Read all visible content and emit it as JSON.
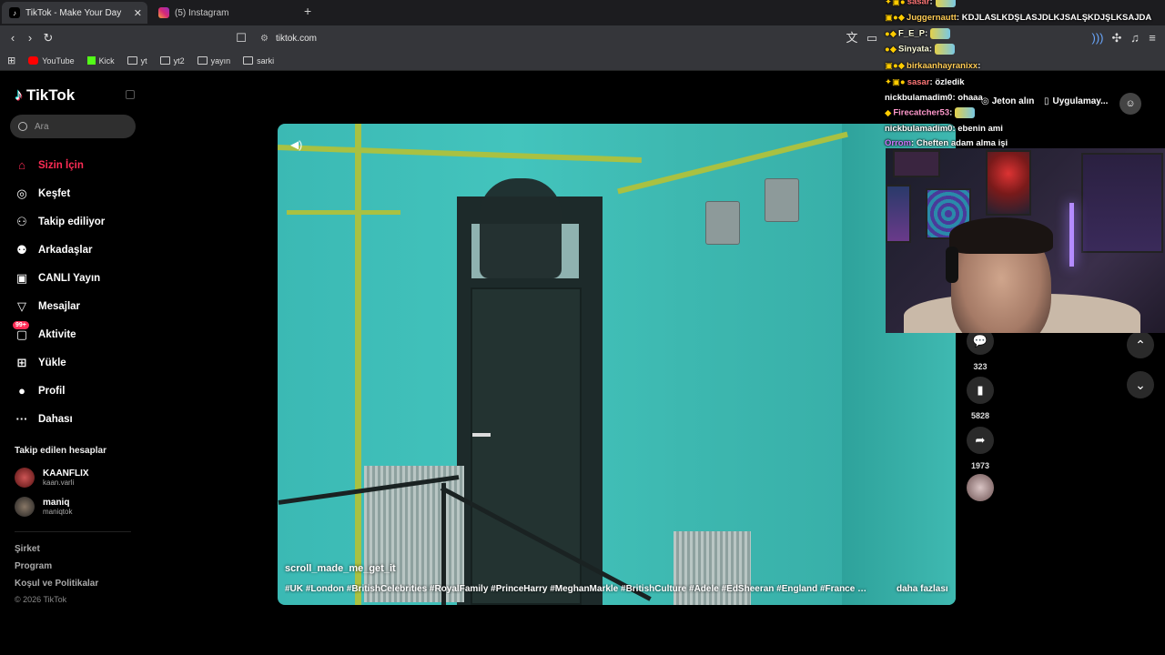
{
  "browser": {
    "tabs": [
      {
        "title": "TikTok - Make Your Day",
        "active": true
      },
      {
        "title": "(5) Instagram",
        "active": false
      }
    ],
    "url": "tiktok.com",
    "bookmarks": [
      "YouTube",
      "Kick",
      "yt",
      "yt2",
      "yayın",
      "sarki"
    ]
  },
  "tiktok": {
    "logo": "TikTok",
    "search_placeholder": "Ara",
    "nav": [
      {
        "label": "Sizin İçin",
        "icon": "home-icon",
        "active": true
      },
      {
        "label": "Keşfet",
        "icon": "compass-icon"
      },
      {
        "label": "Takip ediliyor",
        "icon": "following-icon"
      },
      {
        "label": "Arkadaşlar",
        "icon": "friends-icon"
      },
      {
        "label": "CANLI Yayın",
        "icon": "live-icon"
      },
      {
        "label": "Mesajlar",
        "icon": "messages-icon"
      },
      {
        "label": "Aktivite",
        "icon": "activity-icon",
        "badge": "99+"
      },
      {
        "label": "Yükle",
        "icon": "upload-icon"
      },
      {
        "label": "Profil",
        "icon": "profile-icon"
      },
      {
        "label": "Dahası",
        "icon": "more-icon"
      }
    ],
    "followed_title": "Takip edilen hesaplar",
    "followed": [
      {
        "name": "KAANFLIX",
        "handle": "kaan.varli"
      },
      {
        "name": "maniq",
        "handle": "maniqtok"
      }
    ],
    "footer": [
      "Şirket",
      "Program",
      "Koşul ve Politikalar"
    ],
    "copyright": "© 2026 TikTok",
    "header": {
      "coins": "Jeton alın",
      "app": "Uygulamay..."
    },
    "video": {
      "author": "scroll_made_me_get_it",
      "caption": "#UK #London #BritishCelebrities #RoyalFamily #PrinceHarry #MeghanMarkle #BritishCulture #Adele #EdSheeran #England #France #Paris ...",
      "more": "daha fazlası"
    },
    "actions": [
      {
        "icon": "comment-icon",
        "count": "323"
      },
      {
        "icon": "bookmark-icon",
        "count": "5828"
      },
      {
        "icon": "share-icon",
        "count": "1973"
      }
    ]
  },
  "chat": [
    {
      "user": "sasar",
      "text": ""
    },
    {
      "user": "Juggernautt",
      "text": "KDJLASLKDŞLASJDLKJSALŞKDJŞLKSAJDA"
    },
    {
      "user": "F_E_P",
      "text": ""
    },
    {
      "user": "Sinyata",
      "text": ""
    },
    {
      "user": "birkaanhayranixx",
      "text": ""
    },
    {
      "user": "sasar",
      "text": "özledik"
    },
    {
      "user": "nickbulamadim0",
      "text": "ohaaa"
    },
    {
      "user": "Firecatcher53",
      "text": ""
    },
    {
      "user": "nickbulamadim0",
      "text": "ebenin ami"
    },
    {
      "user": "Orrom",
      "text": "Cheften adam alma işi"
    }
  ]
}
